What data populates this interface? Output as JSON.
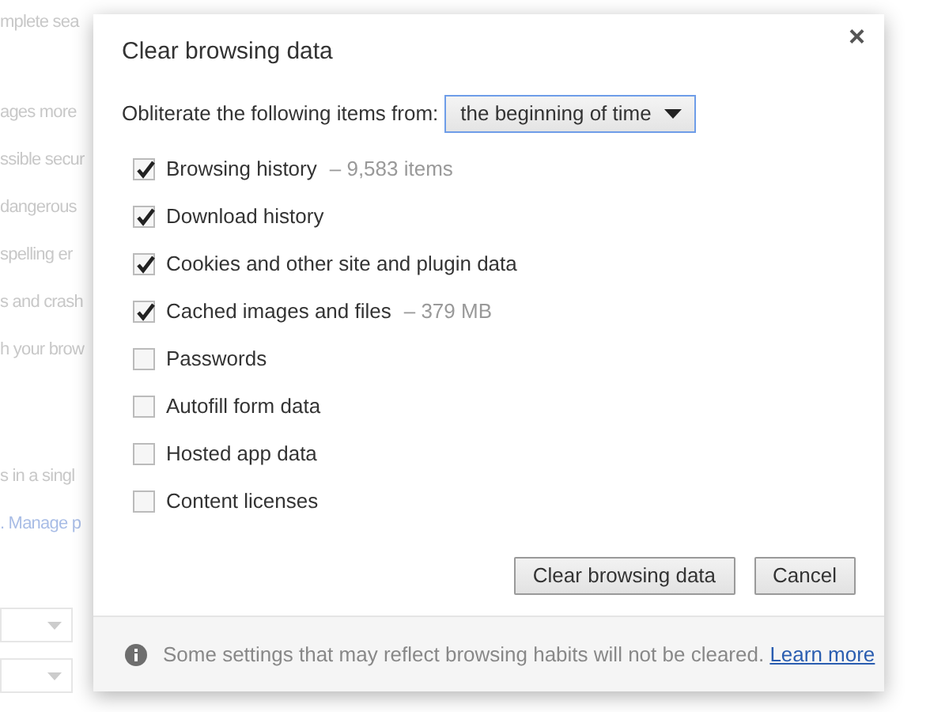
{
  "background_page": {
    "sections": [
      [
        {
          "text": "mplete sea",
          "kind": "text"
        }
      ],
      [
        {
          "text": "ages more",
          "kind": "text"
        },
        {
          "text": "ssible secur",
          "kind": "text"
        },
        {
          "text": "dangerous",
          "kind": "text"
        },
        {
          "text": "spelling er",
          "kind": "text"
        },
        {
          "text": "s and crash",
          "kind": "text"
        },
        {
          "text": "h your brow",
          "kind": "text"
        }
      ],
      [
        {
          "text": "s in a singl",
          "kind": "text"
        },
        {
          "text": ". Manage p",
          "kind": "link"
        }
      ]
    ]
  },
  "dialog": {
    "title": "Clear browsing data",
    "close": "×",
    "period": {
      "label": "Obliterate the following items from:",
      "value": "the beginning of time"
    },
    "items": [
      {
        "label": "Browsing history",
        "detail": "– 9,583 items",
        "checked": true
      },
      {
        "label": "Download history",
        "checked": true
      },
      {
        "label": "Cookies and other site and plugin data",
        "checked": true
      },
      {
        "label": "Cached images and files",
        "detail": "– 379 MB",
        "checked": true
      },
      {
        "label": "Passwords",
        "checked": false
      },
      {
        "label": "Autofill form data",
        "checked": false
      },
      {
        "label": "Hosted app data",
        "checked": false
      },
      {
        "label": "Content licenses",
        "checked": false
      }
    ],
    "buttons": [
      "Clear browsing data",
      "Cancel"
    ],
    "footer": {
      "text": "Some settings that may reflect browsing habits will not be cleared.",
      "link": "Learn more"
    }
  }
}
